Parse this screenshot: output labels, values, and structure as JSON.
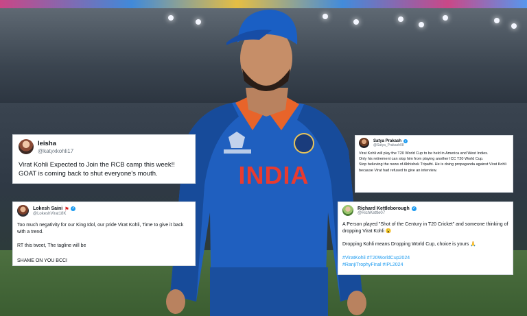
{
  "colors": {
    "jersey_blue": "#1f5fbf",
    "jersey_red": "#e83b30",
    "tweet_link_blue": "#1d9bf0",
    "verified_badge": "#1d9bf0"
  },
  "photo": {
    "jersey_text": "INDIA"
  },
  "tweets": [
    {
      "name": "leisha",
      "handle": "@katyxkohli17",
      "verified": false,
      "lines": [
        "Virat Kohli Expected to Join the RCB camp this week!!",
        "GOAT is coming back to shut everyone's mouth."
      ]
    },
    {
      "name": "Lokesh Saini",
      "name_flag_icon": "flag-icon",
      "handle": "@LokeshVirat18K",
      "verified": true,
      "lines": [
        "Too much negativity for our King Idol, our pride Virat Kohli, Time to give it back with a trend.",
        "RT this tweet, The tagline will be",
        "SHAME ON YOU BCCI"
      ]
    },
    {
      "name": "Satya Prakash",
      "handle": "@Satya_Prakash08",
      "verified": true,
      "lines": [
        "Virat Kohli will play the T20 World Cup to be held in America and West Indies.",
        "Only his retirement can stop him from playing another ICC T20 World Cup.",
        "Stop believing the news of Abhishek Tripathi. He is doing propaganda against Virat Kohli because Virat had refused to give an interview."
      ]
    },
    {
      "name": "Richard Kettleborough",
      "handle": "@RichKettle07",
      "verified": true,
      "lines": [
        "A Person played \"Shot of the Century in T20 Cricket\" and someone thinking of dropping Virat Kohli 😮",
        "Dropping Kohli means Dropping World Cup, choice is yours 🙏"
      ],
      "hashtags_line1": "#ViratKohli #T20WorldCup2024",
      "hashtags_line2": "#RanjiTrophyFinal #IPL2024"
    }
  ]
}
